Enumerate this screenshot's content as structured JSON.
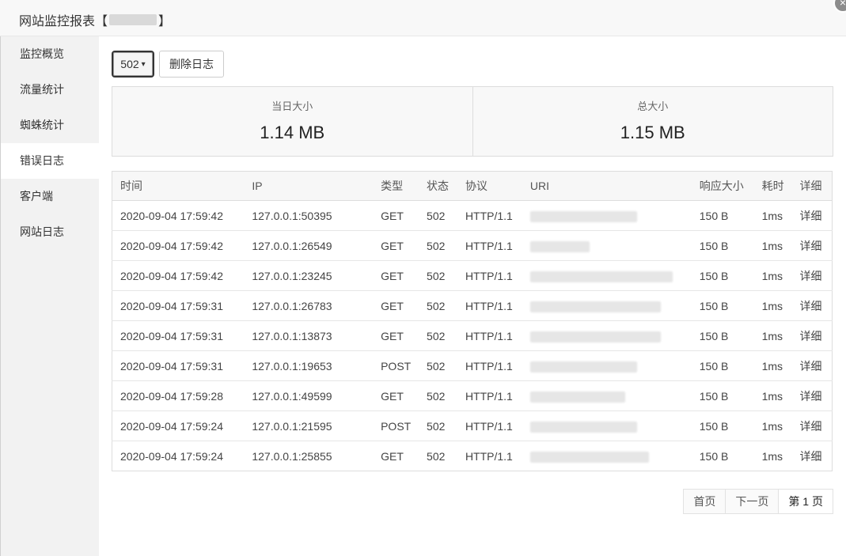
{
  "window": {
    "title_prefix": "网站监控报表【",
    "title_suffix": "】",
    "close_glyph": "×"
  },
  "sidebar": {
    "items": [
      {
        "label": "监控概览"
      },
      {
        "label": "流量统计"
      },
      {
        "label": "蜘蛛统计"
      },
      {
        "label": "错误日志"
      },
      {
        "label": "客户端"
      },
      {
        "label": "网站日志"
      }
    ],
    "active_index": 3
  },
  "toolbar": {
    "status_select": "502",
    "delete_label": "删除日志"
  },
  "stats": {
    "today_label": "当日大小",
    "today_value": "1.14 MB",
    "total_label": "总大小",
    "total_value": "1.15 MB"
  },
  "table": {
    "headers": [
      "时间",
      "IP",
      "类型",
      "状态",
      "协议",
      "URI",
      "响应大小",
      "耗时",
      "详细"
    ],
    "rows": [
      {
        "time": "2020-09-04 17:59:42",
        "ip": "127.0.0.1:50395",
        "method": "GET",
        "status": "502",
        "protocol": "HTTP/1.1",
        "size": "150 B",
        "duration": "1ms",
        "detail": "详细"
      },
      {
        "time": "2020-09-04 17:59:42",
        "ip": "127.0.0.1:26549",
        "method": "GET",
        "status": "502",
        "protocol": "HTTP/1.1",
        "size": "150 B",
        "duration": "1ms",
        "detail": "详细"
      },
      {
        "time": "2020-09-04 17:59:42",
        "ip": "127.0.0.1:23245",
        "method": "GET",
        "status": "502",
        "protocol": "HTTP/1.1",
        "size": "150 B",
        "duration": "1ms",
        "detail": "详细"
      },
      {
        "time": "2020-09-04 17:59:31",
        "ip": "127.0.0.1:26783",
        "method": "GET",
        "status": "502",
        "protocol": "HTTP/1.1",
        "size": "150 B",
        "duration": "1ms",
        "detail": "详细"
      },
      {
        "time": "2020-09-04 17:59:31",
        "ip": "127.0.0.1:13873",
        "method": "GET",
        "status": "502",
        "protocol": "HTTP/1.1",
        "size": "150 B",
        "duration": "1ms",
        "detail": "详细"
      },
      {
        "time": "2020-09-04 17:59:31",
        "ip": "127.0.0.1:19653",
        "method": "POST",
        "status": "502",
        "protocol": "HTTP/1.1",
        "size": "150 B",
        "duration": "1ms",
        "detail": "详细"
      },
      {
        "time": "2020-09-04 17:59:28",
        "ip": "127.0.0.1:49599",
        "method": "GET",
        "status": "502",
        "protocol": "HTTP/1.1",
        "size": "150 B",
        "duration": "1ms",
        "detail": "详细"
      },
      {
        "time": "2020-09-04 17:59:24",
        "ip": "127.0.0.1:21595",
        "method": "POST",
        "status": "502",
        "protocol": "HTTP/1.1",
        "size": "150 B",
        "duration": "1ms",
        "detail": "详细"
      },
      {
        "time": "2020-09-04 17:59:24",
        "ip": "127.0.0.1:25855",
        "method": "GET",
        "status": "502",
        "protocol": "HTTP/1.1",
        "size": "150 B",
        "duration": "1ms",
        "detail": "详细"
      }
    ]
  },
  "pager": {
    "first": "首页",
    "next": "下一页",
    "current": "第 1 页"
  },
  "colors": {
    "accent_green": "#20a53a"
  }
}
